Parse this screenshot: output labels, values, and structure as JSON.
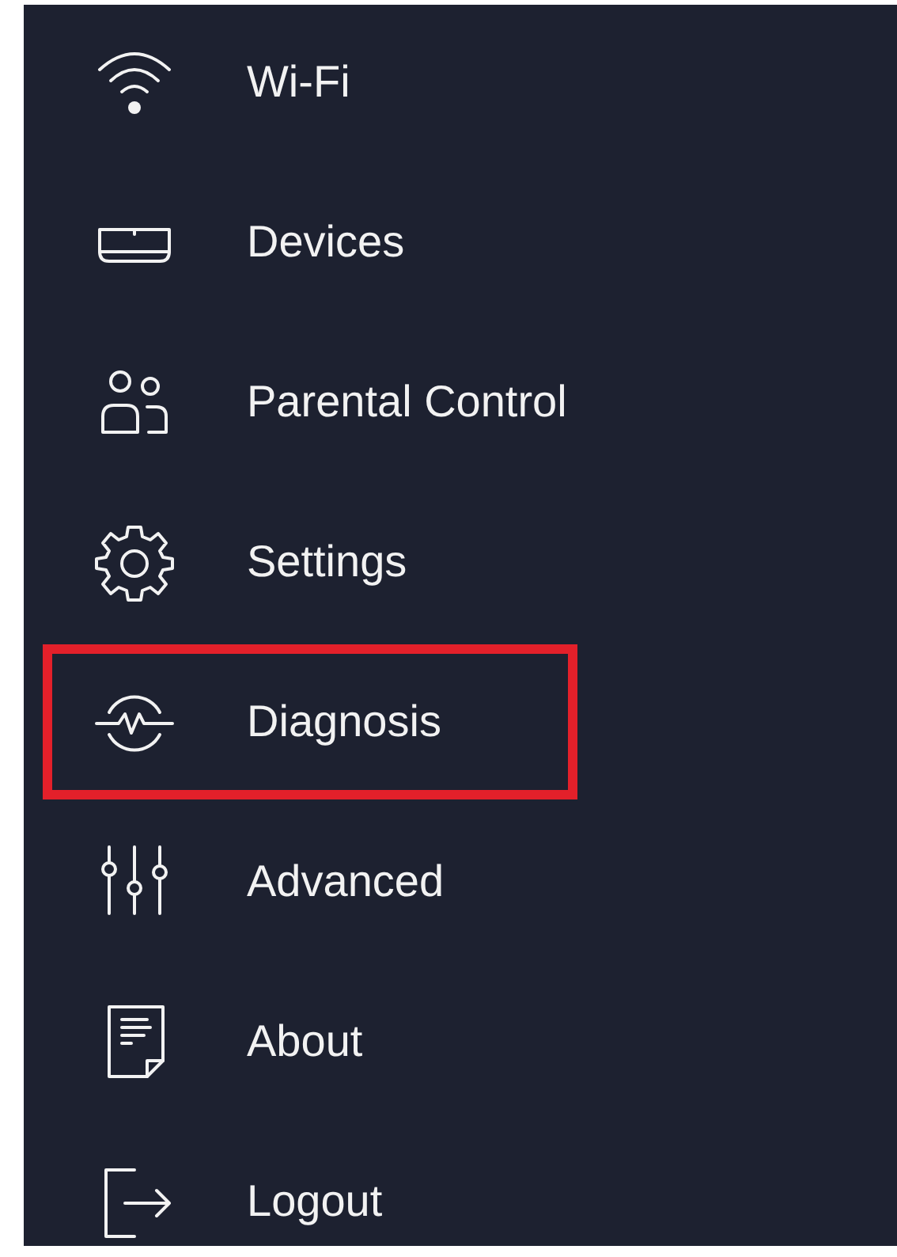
{
  "menu": {
    "items": [
      {
        "label": "Wi-Fi",
        "highlighted": false
      },
      {
        "label": "Devices",
        "highlighted": false
      },
      {
        "label": "Parental Control",
        "highlighted": false
      },
      {
        "label": "Settings",
        "highlighted": false
      },
      {
        "label": "Diagnosis",
        "highlighted": true
      },
      {
        "label": "Advanced",
        "highlighted": false
      },
      {
        "label": "About",
        "highlighted": false
      },
      {
        "label": "Logout",
        "highlighted": false
      }
    ]
  }
}
